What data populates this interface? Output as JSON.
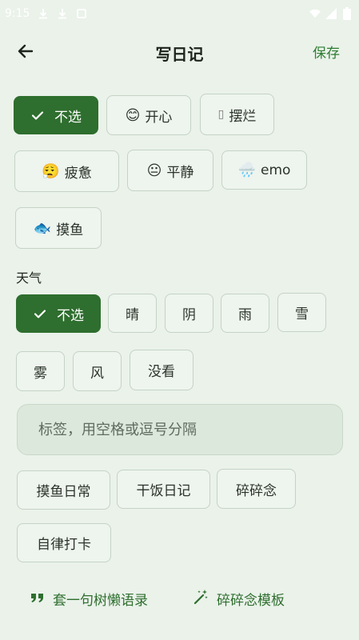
{
  "status_bar": {
    "time": "9:15"
  },
  "header": {
    "title": "写日记",
    "save_label": "保存"
  },
  "mood": {
    "chips": [
      {
        "label": "不选",
        "emoji": "",
        "selected": true
      },
      {
        "label": "开心",
        "emoji": "😊",
        "selected": false
      },
      {
        "label": "摆烂",
        "emoji": "▯",
        "selected": false
      },
      {
        "label": "疲惫",
        "emoji": "😮‍💨",
        "selected": false
      },
      {
        "label": "平静",
        "emoji": "😐",
        "selected": false
      },
      {
        "label": "emo",
        "emoji": "🌧️",
        "selected": false
      },
      {
        "label": "摸鱼",
        "emoji": "🐟",
        "selected": false
      }
    ]
  },
  "weather": {
    "section_label": "天气",
    "chips": [
      {
        "label": "不选",
        "selected": true
      },
      {
        "label": "晴",
        "selected": false
      },
      {
        "label": "阴",
        "selected": false
      },
      {
        "label": "雨",
        "selected": false
      },
      {
        "label": "雪",
        "selected": false
      },
      {
        "label": "雾",
        "selected": false
      },
      {
        "label": "风",
        "selected": false
      },
      {
        "label": "没看",
        "selected": false
      }
    ]
  },
  "tags": {
    "input_value": "",
    "placeholder": "标签，用空格或逗号分隔",
    "suggestions": [
      "摸鱼日常",
      "干饭日记",
      "碎碎念",
      "自律打卡"
    ]
  },
  "actions": {
    "quote_label": "套一句树懒语录",
    "template_label": "碎碎念模板"
  },
  "colors": {
    "background": "#eaf2ea",
    "accent": "#2e6e2e",
    "chip_border": "#c6d3c6",
    "save_text": "#2e7d32"
  }
}
